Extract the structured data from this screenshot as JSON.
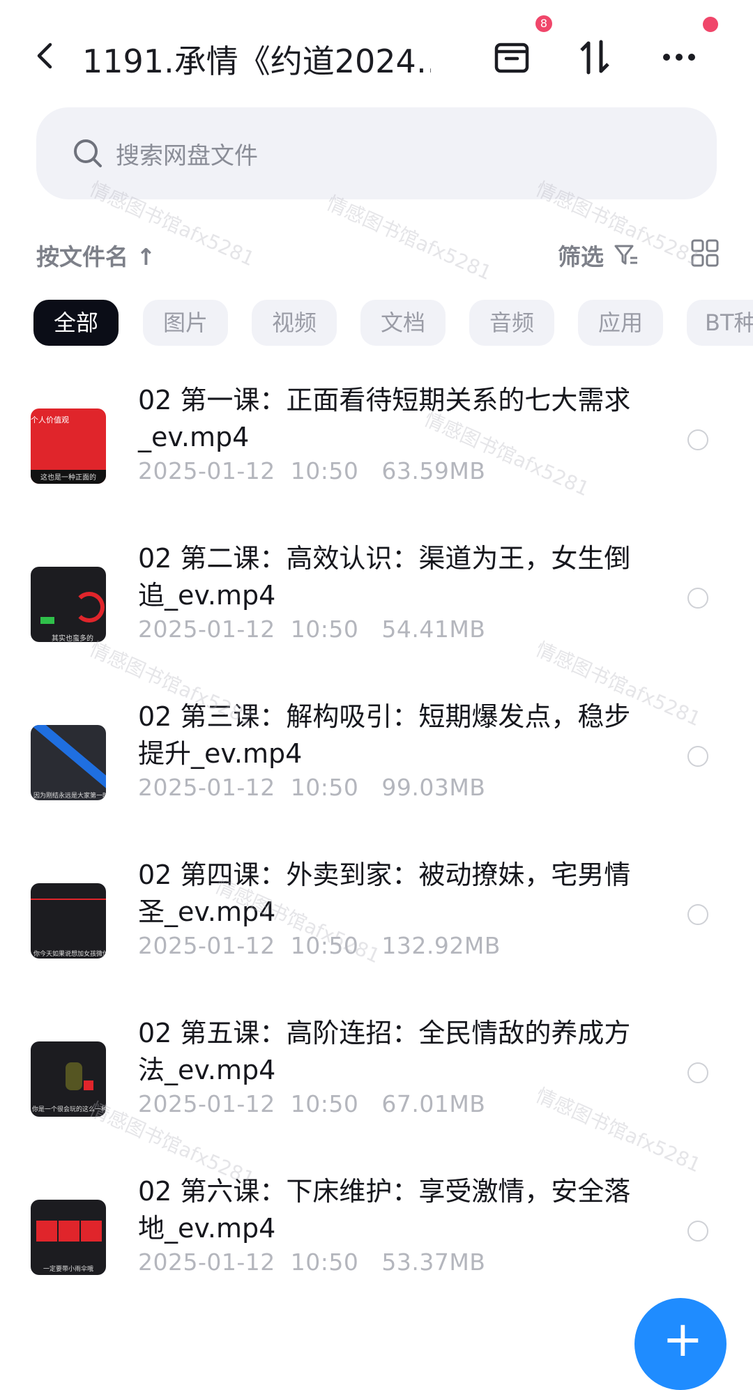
{
  "header": {
    "title": "1191.承情《约道2024…",
    "badge_count": "8"
  },
  "search": {
    "placeholder": "搜索网盘文件"
  },
  "sort": {
    "label": "按文件名",
    "arrow": "↑"
  },
  "filter": {
    "label": "筛选"
  },
  "chips": [
    "全部",
    "图片",
    "视频",
    "文档",
    "音频",
    "应用",
    "BT种"
  ],
  "files": [
    {
      "name": "02 第一课：正面看待短期关系的七大需求_ev.mp4",
      "date": "2025-01-12",
      "time": "10:50",
      "size": "63.59MB",
      "thumb_text_top": "个人价值观",
      "thumb_text_bottom": "这也是一种正面的"
    },
    {
      "name": "02 第二课：高效认识：渠道为王，女生倒追_ev.mp4",
      "date": "2025-01-12",
      "time": "10:50",
      "size": "54.41MB",
      "thumb_text_top": "",
      "thumb_text_bottom": "其实也蛮多的"
    },
    {
      "name": "02 第三课：解构吸引：短期爆发点，稳步提升_ev.mp4",
      "date": "2025-01-12",
      "time": "10:50",
      "size": "99.03MB",
      "thumb_text_top": "",
      "thumb_text_bottom": "因为刚结永远是大家第一时"
    },
    {
      "name": "02 第四课：外卖到家：被动撩妹，宅男情圣_ev.mp4",
      "date": "2025-01-12",
      "time": "10:50",
      "size": "132.92MB",
      "thumb_text_top": "",
      "thumb_text_bottom": "你今天如果说想加女孩微信"
    },
    {
      "name": "02 第五课：高阶连招：全民情敌的养成方法_ev.mp4",
      "date": "2025-01-12",
      "time": "10:50",
      "size": "67.01MB",
      "thumb_text_top": "",
      "thumb_text_bottom": "你是一个很会玩的这么一种人"
    },
    {
      "name": "02 第六课：下床维护：享受激情，安全落地_ev.mp4",
      "date": "2025-01-12",
      "time": "10:50",
      "size": "53.37MB",
      "thumb_text_top": "",
      "thumb_text_bottom": "一定要带小雨伞哦"
    }
  ],
  "watermark": "情感图书馆afx5281",
  "fab": {
    "label": "+"
  },
  "colors": {
    "accent": "#1f8cff",
    "chip_active": "#0b0d17",
    "dot": "#f0466a",
    "thumb_red": "#e0252b"
  }
}
